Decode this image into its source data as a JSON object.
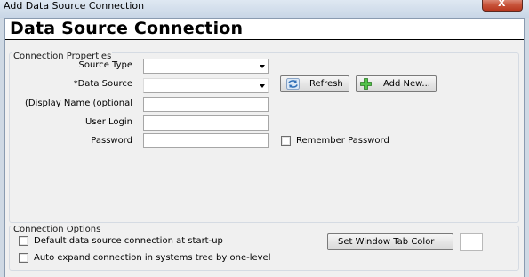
{
  "window": {
    "title": "Add Data Source Connection",
    "close_glyph": "X"
  },
  "banner": {
    "title": "Data Source Connection"
  },
  "connection_properties": {
    "legend": "Connection Properties",
    "source_type_label": "Source Type",
    "source_type_value": "",
    "data_source_label": "*Data Source",
    "data_source_value": "",
    "display_name_label": "(Display Name (optional",
    "display_name_value": "",
    "user_login_label": "User Login",
    "user_login_value": "",
    "password_label": "Password",
    "password_value": "",
    "refresh_label": "Refresh",
    "refresh_icon": "refresh-icon",
    "add_new_label": "Add New...",
    "add_new_icon": "plus-icon",
    "remember_password_label": "Remember Password",
    "remember_password_checked": false
  },
  "connection_options": {
    "legend": "Connection Options",
    "default_connection_label": "Default data source connection at start-up",
    "default_connection_checked": false,
    "auto_expand_label": "Auto expand connection in systems tree by one-level",
    "auto_expand_checked": false,
    "set_tab_color_label": "Set Window Tab Color",
    "tab_color": "#ffffff"
  },
  "colors": {
    "titlebar": "#c8d6e6",
    "close_button": "#c8553c",
    "dialog_background": "#f0f0f0",
    "refresh_icon": "#2f6fb8",
    "add_icon": "#3aa435"
  }
}
